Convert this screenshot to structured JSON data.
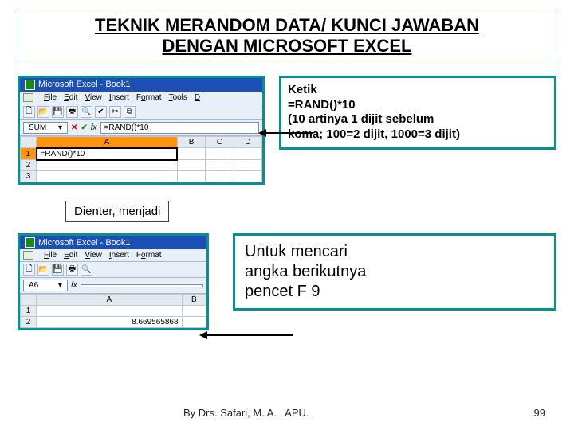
{
  "title_line1": "TEKNIK MERANDOM DATA/ KUNCI JAWABAN",
  "title_line2": "DENGAN MICROSOFT EXCEL",
  "excel1": {
    "window_title": "Microsoft Excel - Book1",
    "menus": [
      "File",
      "Edit",
      "View",
      "Insert",
      "Format",
      "Tools",
      "D"
    ],
    "name_box": "SUM",
    "fx_value": "=RAND()*10",
    "cols": [
      "A",
      "B",
      "C",
      "D"
    ],
    "rows_header": [
      "1",
      "2",
      "3"
    ],
    "a1": "=RAND()*10"
  },
  "callout1": {
    "l1": "Ketik",
    "l2": "=RAND()*10",
    "l3": "(10 artinya 1 dijit sebelum",
    "l4": "koma; 100=2 dijit, 1000=3 dijit)"
  },
  "between_label": "Dienter, menjadi",
  "excel2": {
    "window_title": "Microsoft Excel - Book1",
    "menus": [
      "File",
      "Edit",
      "View",
      "Insert",
      "Format"
    ],
    "name_box": "A6",
    "cols": [
      "A",
      "B"
    ],
    "rows_header": [
      "1",
      "2"
    ],
    "a2": "8.669565868"
  },
  "callout2": {
    "l1": "Untuk mencari",
    "l2": "angka berikutnya",
    "l3": "pencet F 9"
  },
  "footer_author": "By Drs. Safari, M. A. , APU.",
  "page_number": "99"
}
